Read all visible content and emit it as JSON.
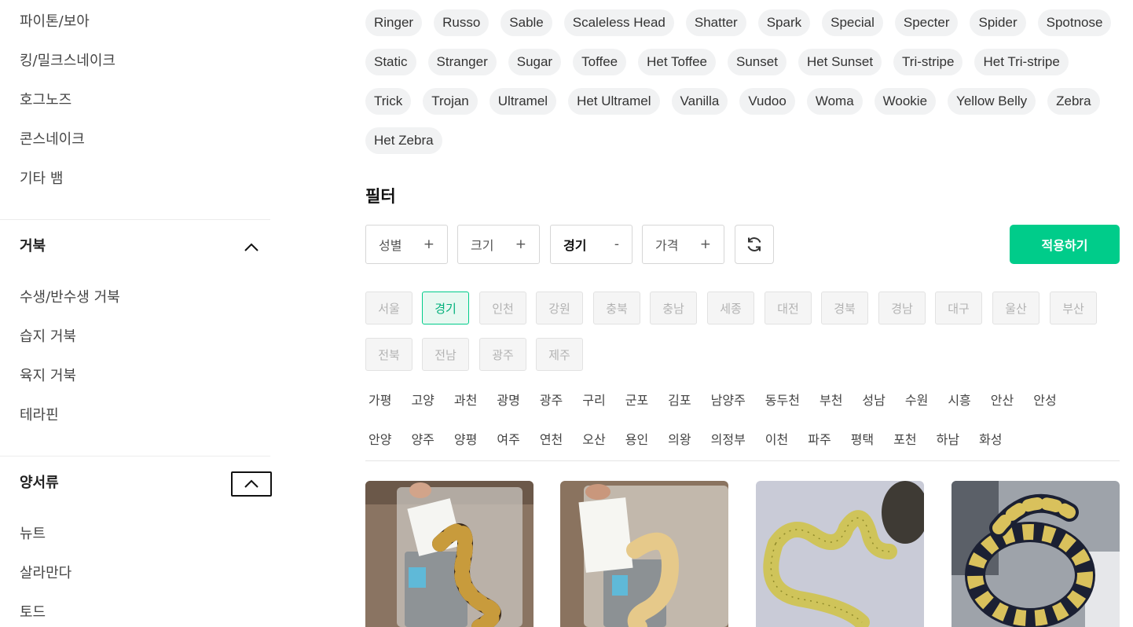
{
  "sidebar": {
    "snake_items": [
      "파이톤/보아",
      "킹/밀크스네이크",
      "호그노즈",
      "콘스네이크",
      "기타 뱀"
    ],
    "turtle": {
      "title": "거북",
      "items": [
        "수생/반수생 거북",
        "습지 거북",
        "육지 거북",
        "테라핀"
      ]
    },
    "amphibian": {
      "title": "양서류",
      "items": [
        "뉴트",
        "살라만다",
        "토드"
      ]
    }
  },
  "morph_rows": [
    [
      "Ringer",
      "Russo",
      "Sable",
      "Scaleless Head",
      "Shatter",
      "Spark",
      "Special",
      "Specter",
      "Spider",
      "Spotnose"
    ],
    [
      "Static",
      "Stranger",
      "Sugar",
      "Toffee",
      "Het Toffee",
      "Sunset",
      "Het Sunset",
      "Tri-stripe",
      "Het Tri-stripe"
    ],
    [
      "Trick",
      "Trojan",
      "Ultramel",
      "Het Ultramel",
      "Vanilla",
      "Vudoo",
      "Woma",
      "Wookie",
      "Yellow Belly",
      "Zebra"
    ],
    [
      "Het Zebra"
    ]
  ],
  "filter": {
    "title": "필터",
    "buttons": [
      {
        "label": "성별",
        "symbol": "+"
      },
      {
        "label": "크기",
        "symbol": "+"
      },
      {
        "label": "경기",
        "symbol": "-"
      },
      {
        "label": "가격",
        "symbol": "+"
      }
    ],
    "apply_label": "적용하기"
  },
  "regions": {
    "row1": [
      "서울",
      "경기",
      "인천",
      "강원",
      "충북",
      "충남",
      "세종",
      "대전",
      "경북",
      "경남",
      "대구",
      "울산",
      "부산"
    ],
    "row2": [
      "전북",
      "전남",
      "광주",
      "제주"
    ],
    "selected": "경기"
  },
  "cities": {
    "row1": [
      "가평",
      "고양",
      "과천",
      "광명",
      "광주",
      "구리",
      "군포",
      "김포",
      "남양주",
      "동두천",
      "부천",
      "성남",
      "수원",
      "시흥",
      "안산",
      "안성"
    ],
    "row2": [
      "안양",
      "양주",
      "양평",
      "여주",
      "연천",
      "오산",
      "용인",
      "의왕",
      "의정부",
      "이천",
      "파주",
      "평택",
      "포천",
      "하남",
      "화성"
    ]
  },
  "colors": {
    "accent": "#00cc8a",
    "tag_bg": "#f1f2f3"
  }
}
